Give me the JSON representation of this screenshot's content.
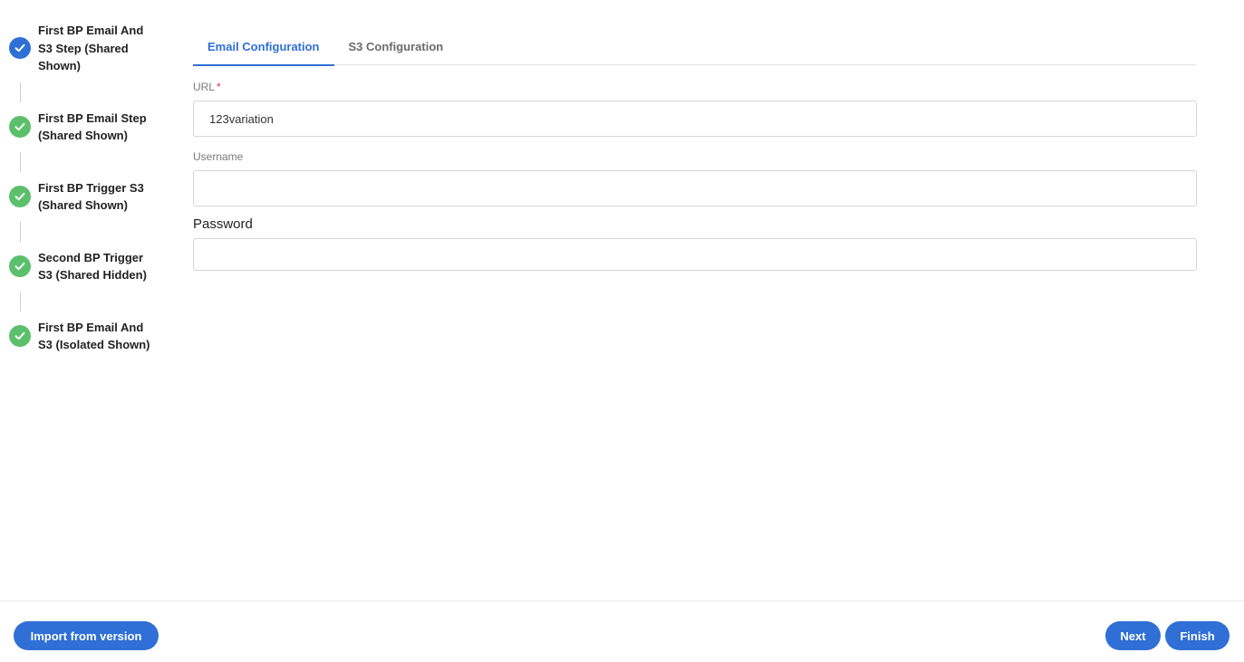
{
  "colors": {
    "accent": "#2f6fd6",
    "step_complete": "#5cbf6c",
    "step_current": "#2f6fd6",
    "required": "#d9363e"
  },
  "stepper": {
    "steps": [
      {
        "label": "First BP Email And S3 Step (Shared Shown)",
        "status": "current",
        "icon": "check-icon"
      },
      {
        "label": "First BP Email Step (Shared Shown)",
        "status": "complete",
        "icon": "check-icon"
      },
      {
        "label": "First BP Trigger S3 (Shared Shown)",
        "status": "complete",
        "icon": "check-icon"
      },
      {
        "label": "Second BP Trigger S3 (Shared Hidden)",
        "status": "complete",
        "icon": "check-icon"
      },
      {
        "label": "First BP Email And S3 (Isolated Shown)",
        "status": "complete",
        "icon": "check-icon"
      }
    ]
  },
  "tabs": [
    {
      "label": "Email Configuration",
      "active": true
    },
    {
      "label": "S3 Configuration",
      "active": false
    }
  ],
  "form": {
    "url": {
      "label": "URL",
      "required_mark": "*",
      "value": "123variation"
    },
    "username": {
      "label": "Username",
      "value": ""
    },
    "password": {
      "label": "Password",
      "value": ""
    }
  },
  "footer": {
    "import_label": "Import from version",
    "next_label": "Next",
    "finish_label": "Finish"
  }
}
